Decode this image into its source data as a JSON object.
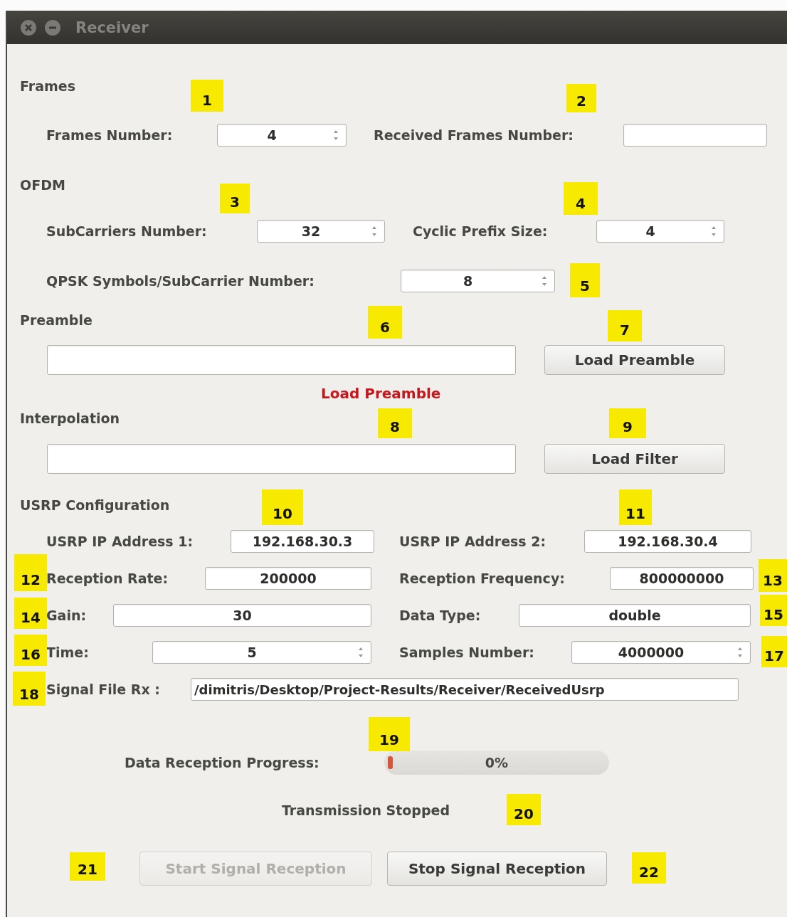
{
  "window": {
    "title": "Receiver"
  },
  "blocks": [
    {
      "kind": "heading",
      "text": "Frames"
    },
    {
      "kind": "fields",
      "items": [
        {
          "kind": "spin",
          "label": "Frames Number:",
          "value": "4"
        },
        {
          "kind": "field",
          "label": "Received Frames Number:"
        }
      ]
    },
    {
      "kind": "heading",
      "text": "OFDM"
    },
    {
      "kind": "fields",
      "items": [
        {
          "kind": "spin",
          "label": "SubCarriers Number:",
          "value": "32"
        },
        {
          "kind": "spin",
          "label": "Cyclic Prefix Size:",
          "value": "4"
        }
      ]
    },
    {
      "kind": "fields",
      "items": [
        {
          "kind": "spin",
          "label": "QPSK Symbols/SubCarrier Number:",
          "value": "8"
        }
      ]
    },
    {
      "kind": "heading",
      "text": "Preamble"
    },
    {
      "kind": "file",
      "button": "Load Preamble"
    },
    {
      "kind": "alert",
      "text": "Load Preamble"
    },
    {
      "kind": "heading",
      "text": "Interpolation"
    },
    {
      "kind": "file",
      "button": "Load Filter"
    },
    {
      "kind": "heading",
      "text": "USRP Configuration"
    },
    {
      "kind": "fields",
      "items": [
        {
          "kind": "field",
          "label": "USRP IP Address 1:",
          "value": "192.168.30.3"
        },
        {
          "kind": "field",
          "label": "USRP IP Address 2:",
          "value": "192.168.30.4"
        }
      ]
    },
    {
      "kind": "fields",
      "items": [
        {
          "kind": "field",
          "label": "Reception Rate:",
          "value": "200000"
        },
        {
          "kind": "field",
          "label": "Reception Frequency:",
          "value": "800000000"
        }
      ]
    },
    {
      "kind": "fields",
      "items": [
        {
          "kind": "field",
          "label": "Gain:",
          "value": "30"
        },
        {
          "kind": "field",
          "label": "Data Type:",
          "value": "double"
        }
      ]
    },
    {
      "kind": "fields",
      "items": [
        {
          "kind": "spin",
          "label": "Time:",
          "value": "5"
        },
        {
          "kind": "spin",
          "label": "Samples Number:",
          "value": "4000000"
        }
      ]
    },
    {
      "kind": "fields",
      "items": [
        {
          "kind": "path",
          "label": "Signal File Rx :",
          "value": "/dimitris/Desktop/Project-Results/Receiver/ReceivedUsrp"
        }
      ]
    },
    {
      "kind": "progress",
      "label": "Data Reception Progress:",
      "level": 0,
      "reading": "0%"
    },
    {
      "kind": "status",
      "text": "Transmission Stopped"
    },
    {
      "kind": "buttons",
      "items": [
        {
          "label": "Start Signal Reception",
          "disabled": true
        },
        {
          "label": "Stop Signal Reception",
          "disabled": false
        }
      ]
    }
  ],
  "callouts": [
    "1",
    "2",
    "3",
    "4",
    "5",
    "6",
    "7",
    "8",
    "9",
    "10",
    "11",
    "12",
    "13",
    "14",
    "15",
    "16",
    "17",
    "18",
    "19",
    "20",
    "21",
    "22"
  ]
}
